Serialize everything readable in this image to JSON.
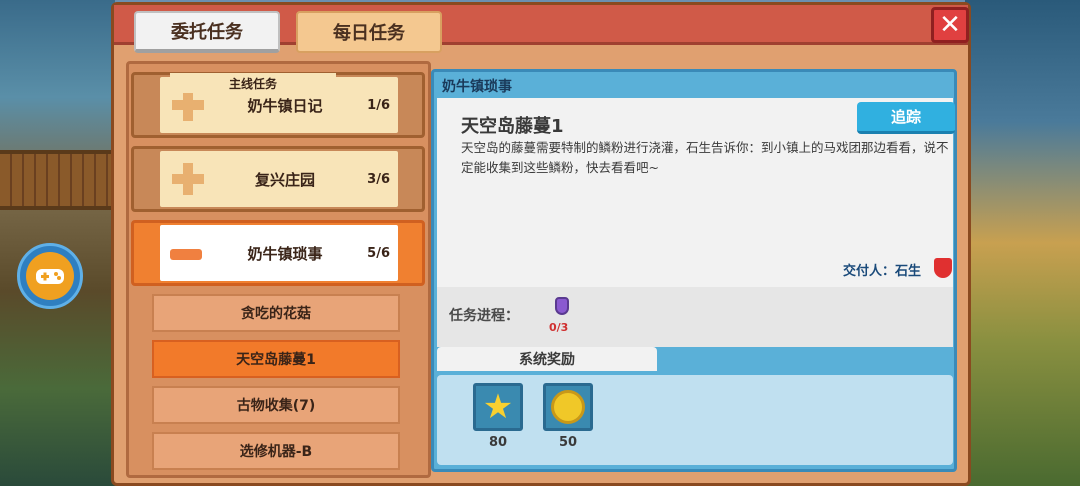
{
  "tabs": [
    {
      "label": "委托任务",
      "active": true
    },
    {
      "label": "每日任务",
      "active": false
    }
  ],
  "close_icon": "close-icon",
  "quest_list": {
    "main_tag": "主线任务",
    "groups": [
      {
        "name": "奶牛镇日记",
        "progress": "1/6",
        "expanded": false
      },
      {
        "name": "复兴庄园",
        "progress": "3/6",
        "expanded": false
      },
      {
        "name": "奶牛镇琐事",
        "progress": "5/6",
        "expanded": true
      }
    ],
    "sub_items": [
      {
        "name": "贪吃的花菇",
        "selected": false
      },
      {
        "name": "天空岛藤蔓1",
        "selected": true
      },
      {
        "name": "古物收集(7)",
        "selected": false
      },
      {
        "name": "选修机器-B",
        "selected": false
      }
    ]
  },
  "detail": {
    "header": "奶牛镇琐事",
    "title": "天空岛藤蔓1",
    "track_label": "追踪",
    "description": "天空岛的藤蔓需要特制的鳞粉进行浇灌，石生告诉你：到小镇上的马戏团那边看看，说不定能收集到这些鳞粉，快去看看吧~",
    "giver": "交付人：石生",
    "progress_label": "任务进程：",
    "progress_count": "0/3",
    "reward_tab": "系统奖励",
    "rewards": [
      {
        "icon": "star-icon",
        "amount": "80"
      },
      {
        "icon": "coin-icon",
        "amount": "50"
      }
    ]
  }
}
